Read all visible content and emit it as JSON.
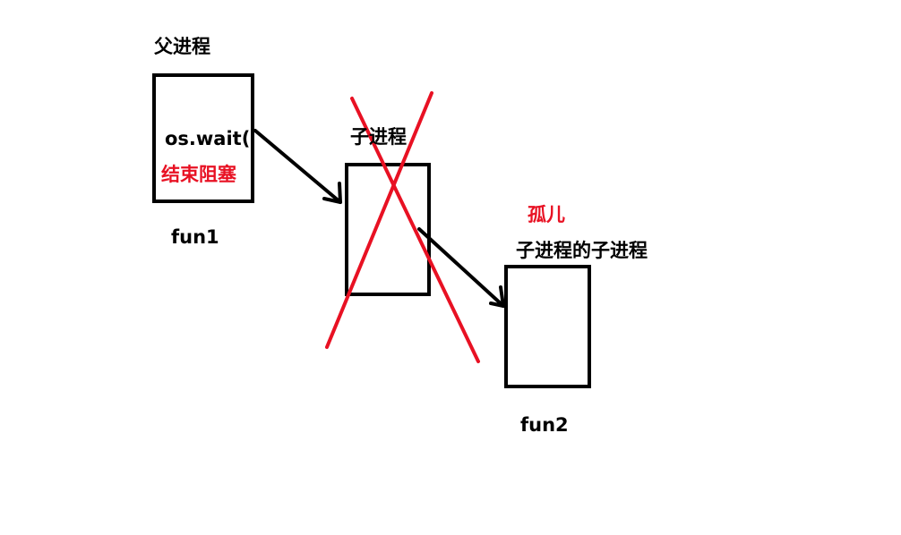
{
  "labels": {
    "parent_process": "父进程",
    "wait_call": "os.wait(",
    "end_blocking": "结束阻塞",
    "fun1": "fun1",
    "child_process": "子进程",
    "orphan": "孤儿",
    "grandchild_process": "子进程的子进程",
    "fun2": "fun2"
  },
  "colors": {
    "stroke": "#000000",
    "annotation_red": "#e81123",
    "background": "#ffffff"
  }
}
